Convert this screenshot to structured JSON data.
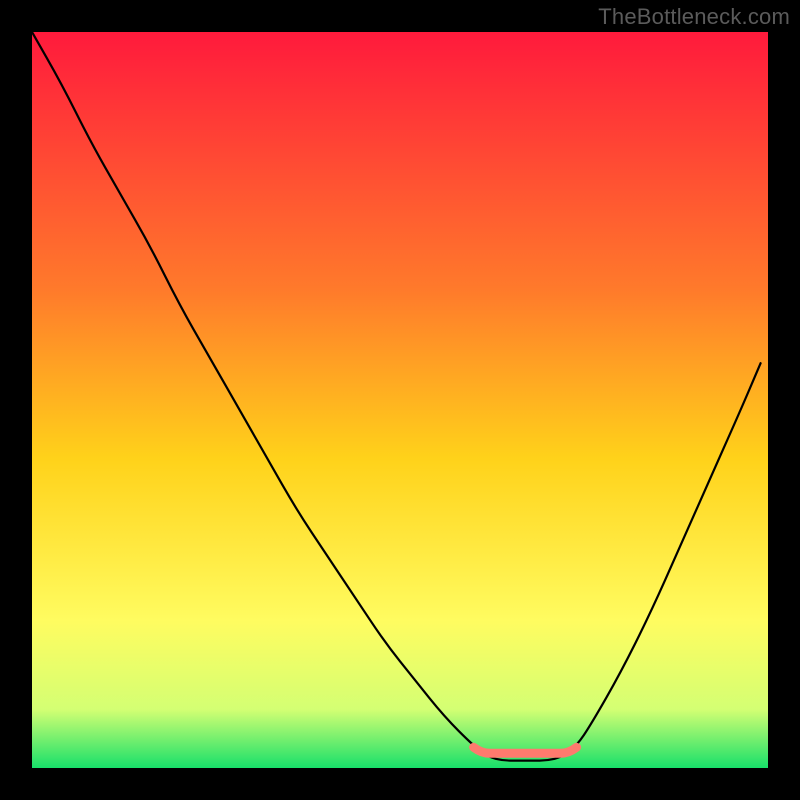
{
  "watermark": "TheBottleneck.com",
  "colors": {
    "gradient_top": "#ff1a3c",
    "gradient_mid1": "#ff7a2b",
    "gradient_mid2": "#ffd21a",
    "gradient_low1": "#fffc60",
    "gradient_low2": "#d4ff73",
    "gradient_bottom": "#18e06a",
    "curve": "#000000",
    "marker": "#ff7a6e",
    "frame": "#000000"
  },
  "chart_data": {
    "type": "line",
    "title": "",
    "xlabel": "",
    "ylabel": "",
    "xlim": [
      0,
      100
    ],
    "ylim": [
      0,
      100
    ],
    "x": [
      0,
      4,
      8,
      12,
      16,
      20,
      24,
      28,
      32,
      36,
      40,
      44,
      48,
      52,
      56,
      60,
      62,
      64,
      66,
      68,
      70,
      72,
      74,
      76,
      80,
      84,
      88,
      92,
      96,
      99
    ],
    "values": [
      100,
      93,
      85,
      78,
      71,
      63,
      56,
      49,
      42,
      35,
      29,
      23,
      17,
      12,
      7,
      3,
      1.5,
      1,
      1,
      1,
      1,
      1.5,
      3,
      6,
      13,
      21,
      30,
      39,
      48,
      55
    ],
    "annotations": [
      {
        "name": "optimal-range-marker",
        "x_start": 60,
        "x_end": 74,
        "y": 2
      }
    ]
  }
}
